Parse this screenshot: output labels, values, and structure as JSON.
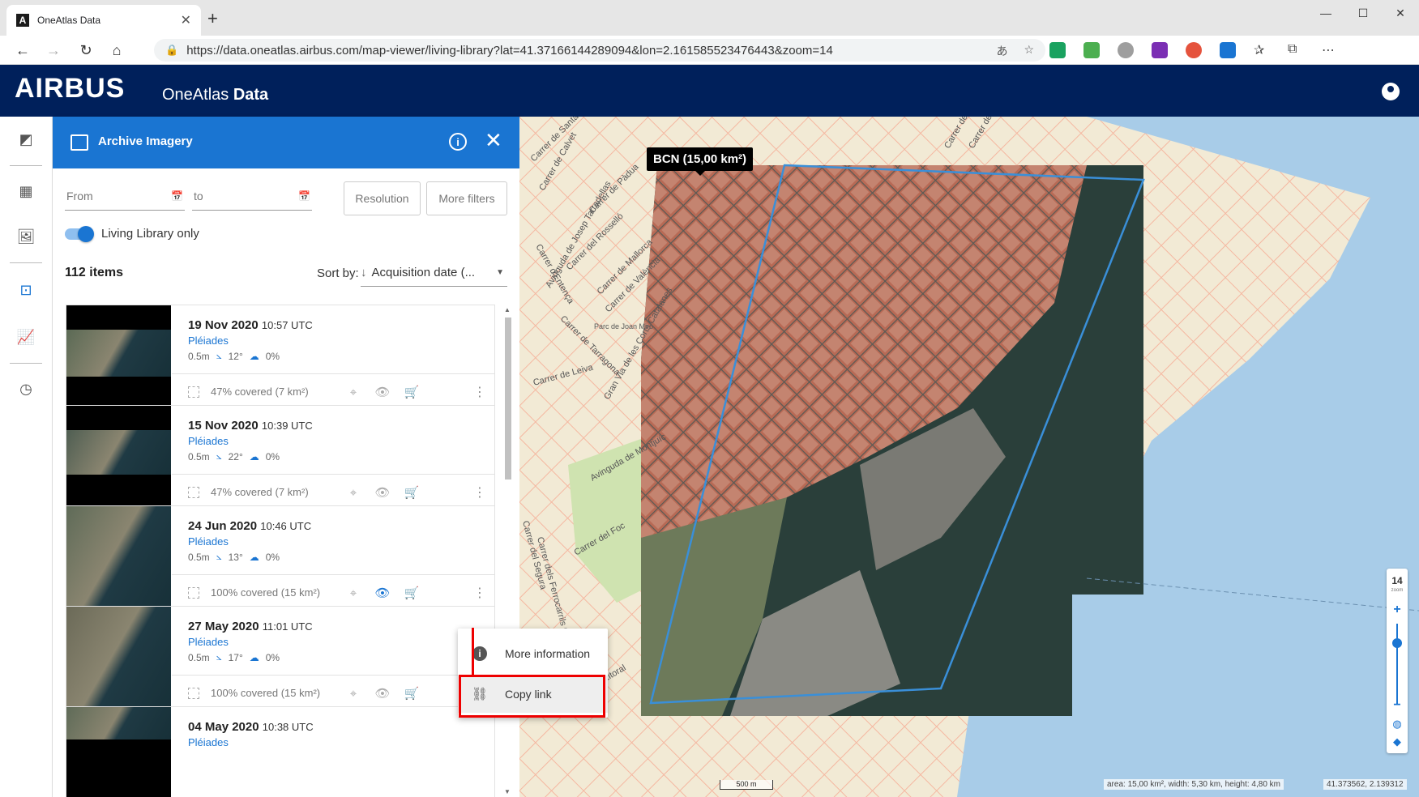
{
  "browser": {
    "tab_title": "OneAtlas Data",
    "url": "https://data.oneatlas.airbus.com/map-viewer/living-library?lat=41.37166144289094&lon=2.161585523476443&zoom=14"
  },
  "header": {
    "logo": "AIRBUS",
    "product_prefix": "OneAtlas ",
    "product_bold": "Data"
  },
  "panel": {
    "title": "Archive Imagery",
    "from_placeholder": "From",
    "to_placeholder": "to",
    "resolution_btn": "Resolution",
    "more_filters_btn": "More filters",
    "living_library_label": "Living Library only",
    "living_library_on": true,
    "items_count": "112 items",
    "sort_label": "Sort by:",
    "sort_value": "Acquisition date (..."
  },
  "cards": [
    {
      "date": "19 Nov 2020",
      "time": "10:57 UTC",
      "sensor": "Pléiades",
      "res": "0.5m",
      "angle": "12°",
      "cloud": "0%",
      "coverage": "47% covered (7 km²)",
      "preview_active": false
    },
    {
      "date": "15 Nov 2020",
      "time": "10:39 UTC",
      "sensor": "Pléiades",
      "res": "0.5m",
      "angle": "22°",
      "cloud": "0%",
      "coverage": "47% covered (7 km²)",
      "preview_active": false
    },
    {
      "date": "24 Jun 2020",
      "time": "10:46 UTC",
      "sensor": "Pléiades",
      "res": "0.5m",
      "angle": "13°",
      "cloud": "0%",
      "coverage": "100% covered (15 km²)",
      "preview_active": true
    },
    {
      "date": "27 May 2020",
      "time": "11:01 UTC",
      "sensor": "Pléiades",
      "res": "0.5m",
      "angle": "17°",
      "cloud": "0%",
      "coverage": "100% covered (15 km²)",
      "preview_active": false
    },
    {
      "date": "04 May 2020",
      "time": "10:38 UTC",
      "sensor": "Pléiades",
      "res": "",
      "angle": "",
      "cloud": "",
      "coverage": "",
      "preview_active": false
    }
  ],
  "context_menu": {
    "more_info": "More information",
    "copy_link": "Copy link"
  },
  "map": {
    "aoi_label": "BCN (15,00 km²)",
    "zoom_level": "14",
    "zoom_sub": "zoom",
    "scale_label": "500 m",
    "area_status": "area: 15,00 km², width: 5,30 km, height: 4,80 km",
    "coords": "41.373562, 2.139312",
    "street_labels": [
      "Carrer de Santaló",
      "Carrer de Calvet",
      "Carrer de Pàdua",
      "Carrer del Rosselló",
      "Carrer de Mallorca",
      "Carrer de València",
      "Avinguda de Josep Tarradellas",
      "Carrer d'Entença",
      "Carrer de Tarragona",
      "Parc de Joan Miró",
      "Carrer de Leiva",
      "Gran Via de les Corts Catalanes",
      "Avinguda de Montjuïc",
      "Carrer del Segura",
      "Carrer dels Ferrocarrils Catalans",
      "Carrer del Foc",
      "Ronda del Litoral",
      "Carrer de Pallars",
      "Carrer dels Almogàvers"
    ]
  },
  "colors": {
    "header_bg": "#00205b",
    "panel_head_bg": "#1a75d2",
    "accent": "#1a75d2",
    "aoi_stroke": "#3a8fd8",
    "sea": "#a8cce8",
    "land": "#f2ead5",
    "highlight": "#e00000"
  }
}
